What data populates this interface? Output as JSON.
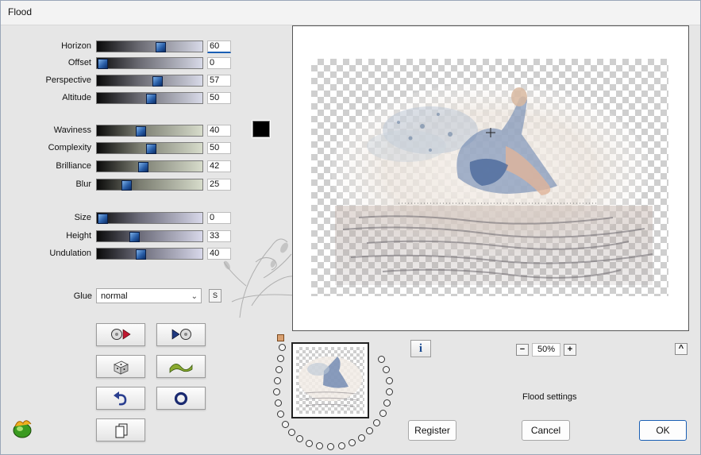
{
  "window": {
    "title": "Flood"
  },
  "sliders": [
    {
      "id": "horizon",
      "label": "Horizon",
      "value": "60",
      "fraction": 0.6,
      "style": "g1",
      "active": true
    },
    {
      "id": "offset",
      "label": "Offset",
      "value": "0",
      "fraction": 0.0,
      "style": "g1"
    },
    {
      "id": "perspective",
      "label": "Perspective",
      "value": "57",
      "fraction": 0.57,
      "style": "g1"
    },
    {
      "id": "altitude",
      "label": "Altitude",
      "value": "50",
      "fraction": 0.5,
      "style": "g1"
    },
    {
      "id": "waviness",
      "label": "Waviness",
      "value": "40",
      "fraction": 0.4,
      "style": "g2"
    },
    {
      "id": "complexity",
      "label": "Complexity",
      "value": "50",
      "fraction": 0.5,
      "style": "g2"
    },
    {
      "id": "brilliance",
      "label": "Brilliance",
      "value": "42",
      "fraction": 0.42,
      "style": "g2"
    },
    {
      "id": "blur",
      "label": "Blur",
      "value": "25",
      "fraction": 0.25,
      "style": "g2"
    },
    {
      "id": "size",
      "label": "Size",
      "value": "0",
      "fraction": 0.0,
      "style": "g3"
    },
    {
      "id": "height",
      "label": "Height",
      "value": "33",
      "fraction": 0.33,
      "style": "g3"
    },
    {
      "id": "undulation",
      "label": "Undulation",
      "value": "40",
      "fraction": 0.4,
      "style": "g3"
    }
  ],
  "color_swatch": "#000000",
  "glue": {
    "label": "Glue",
    "value": "normal",
    "s_button": "S"
  },
  "preview": {
    "zoom": "50%",
    "minus": "−",
    "plus": "+",
    "up": "^",
    "info": "i"
  },
  "status_text": "Flood settings",
  "buttons": {
    "register": "Register",
    "cancel": "Cancel",
    "ok": "OK"
  },
  "colors": {
    "accent": "#1a5fb4",
    "thumb": "#2a5fa8"
  }
}
